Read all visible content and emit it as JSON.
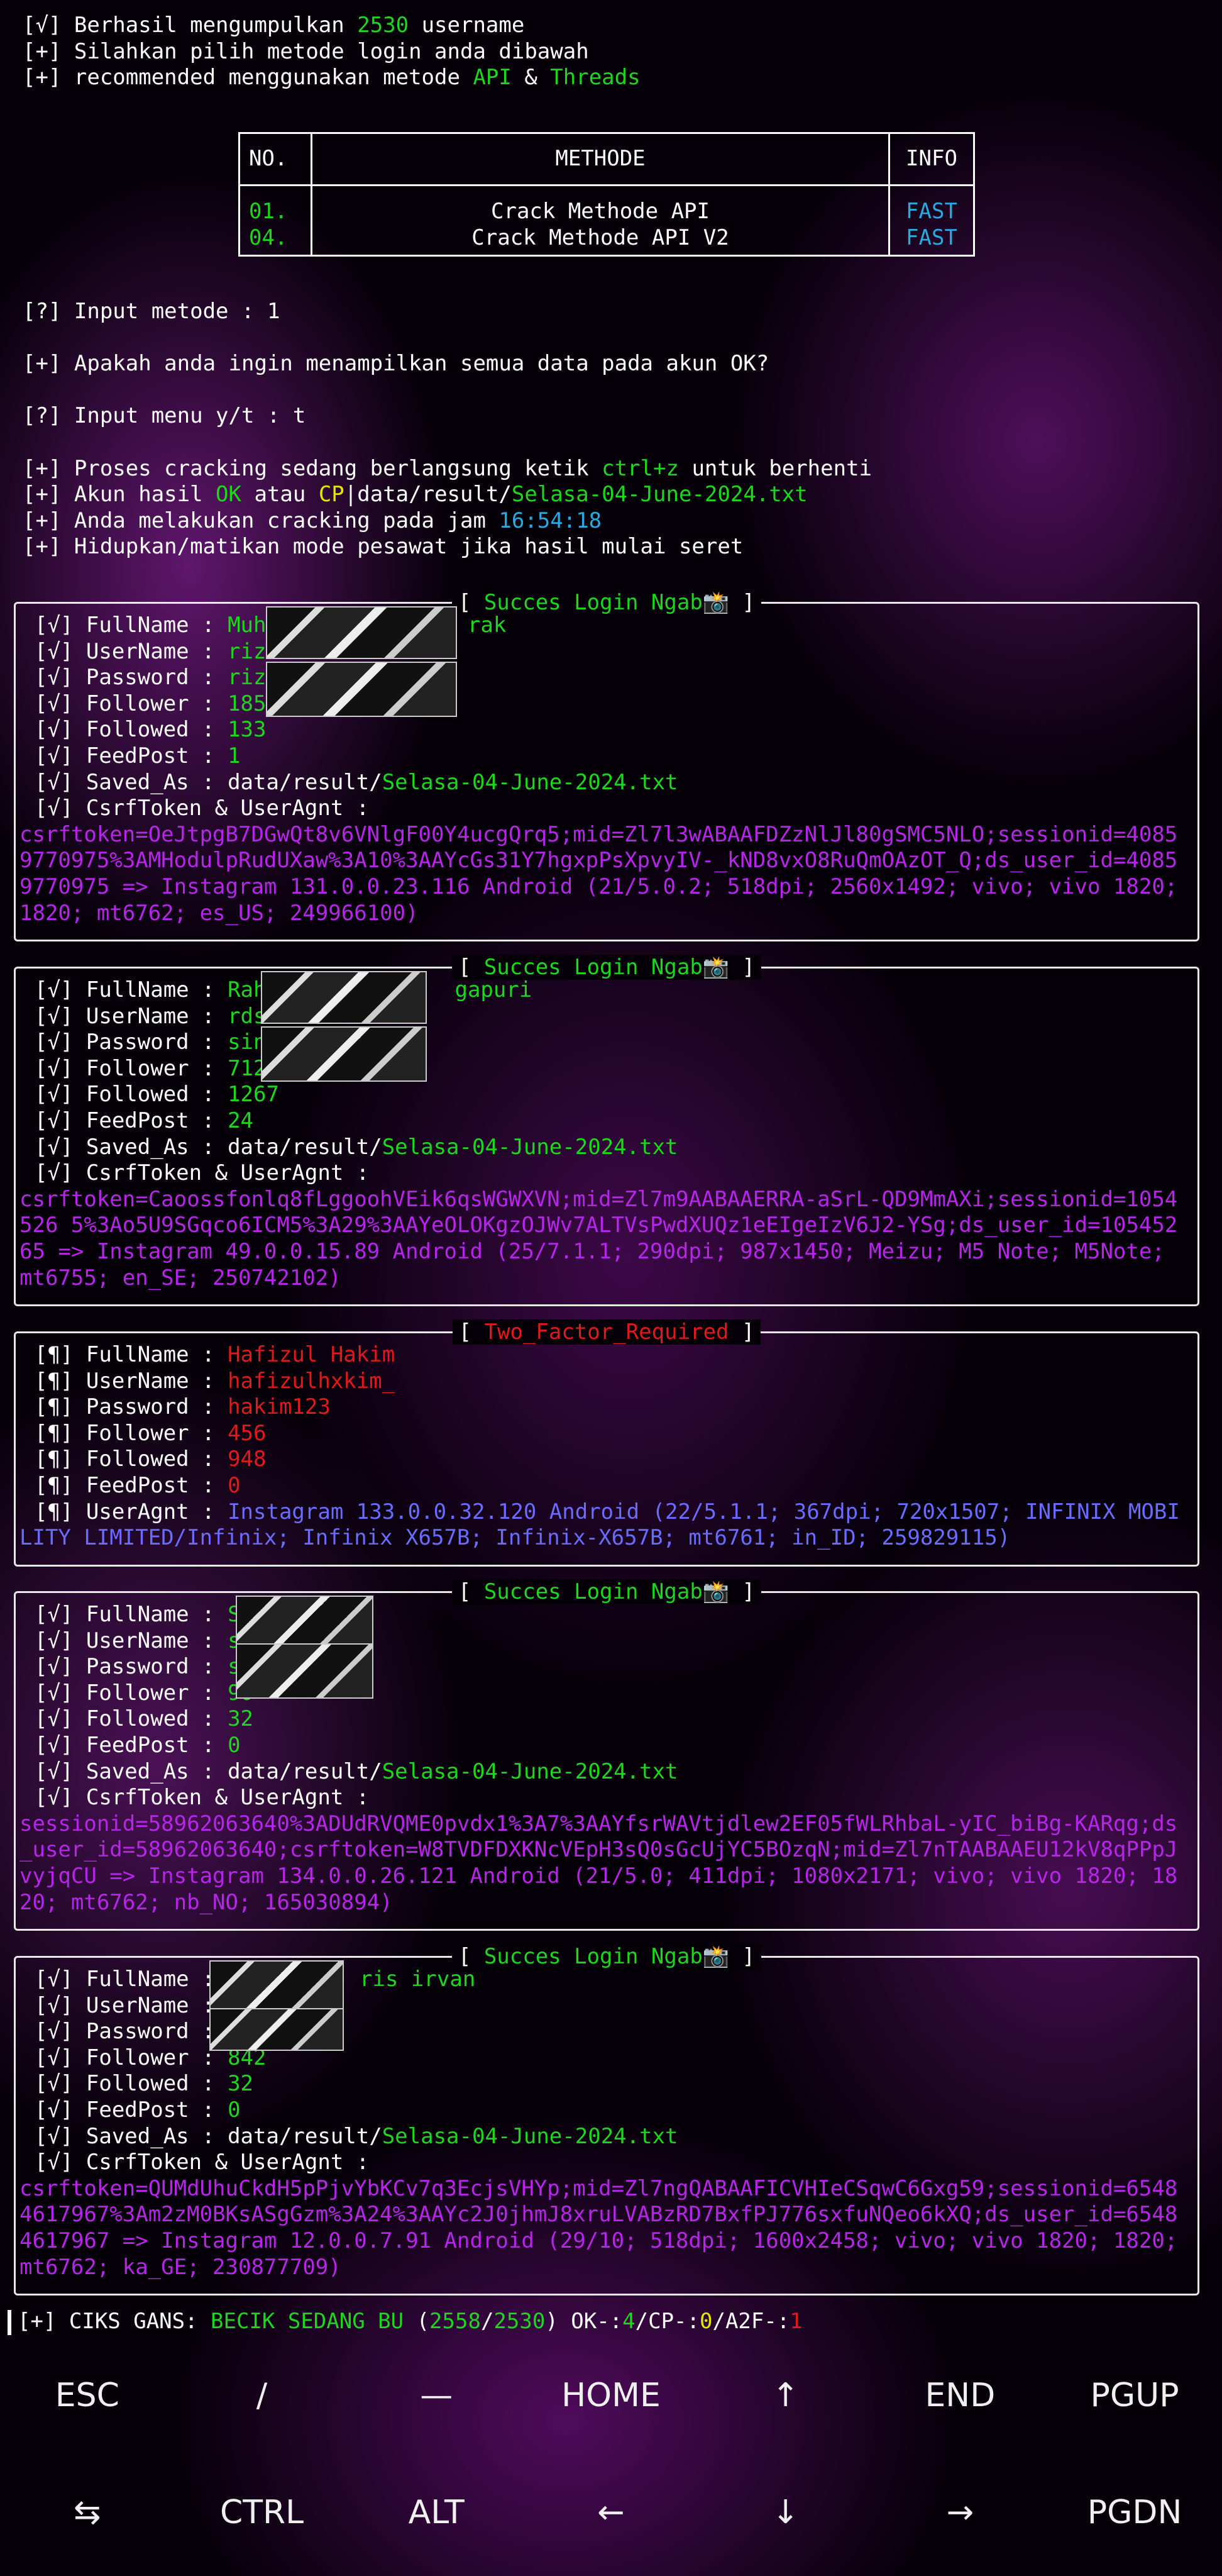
{
  "header": {
    "l1_prefix": "[√] Berhasil mengumpulkan ",
    "l1_count": "2530",
    "l1_suffix": " username",
    "l2": "[+] Silahkan pilih metode login anda dibawah",
    "l3_prefix": "[+] recommended menggunakan metode ",
    "l3_api": "API",
    "l3_and": " & ",
    "l3_threads": "Threads"
  },
  "menu": {
    "col_no": "NO.",
    "col_method": "METHODE",
    "col_info": "INFO",
    "rows": [
      {
        "no": "01.",
        "method": "Crack Methode API",
        "info": "FAST"
      },
      {
        "no": "04.",
        "method": "Crack Methode API V2",
        "info": "FAST"
      }
    ]
  },
  "prompts": {
    "input_metode": "[?] Input metode : 1",
    "show_all": "[+] Apakah anda ingin menampilkan semua data pada akun OK?",
    "input_menu": "[?] Input menu y/t : t",
    "p1_pre": "[+] Proses cracking sedang berlangsung ketik ",
    "p1_key": "ctrl+z",
    "p1_post": " untuk berhenti",
    "p2_pre": "[+] Akun hasil ",
    "p2_ok": "OK",
    "p2_mid": " atau ",
    "p2_cp": "CP",
    "p2_path": "|data/result/",
    "p2_file": "Selasa-04-June-2024.txt",
    "p3_pre": "[+] Anda melakukan cracking pada jam ",
    "p3_time": "16:54:18",
    "p4": "[+] Hidupkan/matikan mode pesawat jika hasil mulai seret"
  },
  "panels": [
    {
      "title": "Succes Login Ngab📸",
      "fullname": "Muha",
      "fullname_tail": "rak",
      "username": "rizk",
      "password": "rizk",
      "follower": "185",
      "followed": "133",
      "feedpost": "1",
      "saved_path": "data/result/",
      "saved_file": "Selasa-04-June-2024.txt",
      "token": "csrftoken=OeJtpgB7DGwQt8v6VNlgF00Y4ucgQrq5;mid=Zl7l3wABAAFDZzNlJl80gSMC5NLO;sessionid=40859770975%3AMHodulpRudUXaw%3A10%3AAYcGs31Y7hgxpPsXpvyIV-_kND8vxO8RuQmOAzOT_Q;ds_user_id=40859770975 => Instagram 131.0.0.23.116 Android (21/5.0.2; 518dpi; 2560x1492; vivo; vivo 1820; 1820; mt6762; es_US; 249966100)"
    },
    {
      "title": "Succes Login Ngab📸",
      "fullname": "Rah",
      "fullname_tail": "gapuri",
      "username": "rds",
      "password": "sin",
      "follower": "712",
      "followed": "1267",
      "feedpost": "24",
      "saved_path": "data/result/",
      "saved_file": "Selasa-04-June-2024.txt",
      "token": "csrftoken=Caoossfonlq8fLggoohVEik6qsWGWXVN;mid=Zl7m9AABAAERRA-aSrL-QD9MmAXi;sessionid=1054526 5%3Ao5U9SGqco6ICM5%3A29%3AAYeOLOKgzOJWv7ALTVsPwdXUQz1eEIgeIzV6J2-YSg;ds_user_id=10545265 => Instagram 49.0.0.15.89 Android (25/7.1.1; 290dpi; 987x1450; Meizu; M5 Note; M5Note; mt6755; en_SE; 250742102)"
    },
    {
      "title": "Two_Factor_Required",
      "fullname": "Hafizul Hakim",
      "username": "hafizulhxkim_",
      "password": "hakim123",
      "follower": "456",
      "followed": "948",
      "feedpost": "0",
      "useragent": "Instagram 133.0.0.32.120 Android (22/5.1.1; 367dpi; 720x1507; INFINIX MOBILITY LIMITED/Infinix; Infinix X657B; Infinix-X657B; mt6761; in_ID; 259829115)"
    },
    {
      "title": "Succes Login Ngab📸",
      "fullname": "S",
      "username": "s",
      "password": "s",
      "follower": "90",
      "followed": "32",
      "feedpost": "0",
      "saved_path": "data/result/",
      "saved_file": "Selasa-04-June-2024.txt",
      "token": "sessionid=58962063640%3ADUdRVQME0pvdx1%3A7%3AAYfsrWAVtjdlew2EF05fWLRhbaL-yIC_biBg-KARqg;ds_user_id=58962063640;csrftoken=W8TVDFDXKNcVEpH3sQ0sGcUjYC5BOzqN;mid=Zl7nTAABAAEU12kV8qPPpJvyjqCU => Instagram 134.0.0.26.121 Android (21/5.0; 411dpi; 1080x2171; vivo; vivo 1820; 1820; mt6762; nb_NO; 165030894)"
    },
    {
      "title": "Succes Login Ngab📸",
      "fullname": "",
      "fullname_tail": "ris irvan",
      "username": "",
      "password": "",
      "follower": "842",
      "followed": "32",
      "feedpost": "0",
      "saved_path": "data/result/",
      "saved_file": "Selasa-04-June-2024.txt",
      "token": "csrftoken=QUMdUhuCkdH5pPjvYbKCv7q3EcjsVHYp;mid=Zl7ngQABAAFICVHIeCSqwC6Gxg59;sessionid=65484617967%3Am2zM0BKsASgGzm%3A24%3AAYc2J0jhmJ8xruLVABzRD7BxfPJ776sxfuNQeo6kXQ;ds_user_id=65484617967 => Instagram 12.0.0.7.91 Android (29/10; 518dpi; 1600x2458; vivo; vivo 1820; 1820; mt6762; ka_GE; 230877709)"
    }
  ],
  "labels": {
    "fullname": "FullName : ",
    "username": "UserName : ",
    "password": "Password : ",
    "follower": "Follower : ",
    "followed": "Followed : ",
    "feedpost": "FeedPost : ",
    "saved": "Saved_As : ",
    "token": "CsrfToken & UserAgnt :",
    "useragent": "UserAgnt : ",
    "ok_mark": "[√] ",
    "tf_mark": "[¶] "
  },
  "status": {
    "pre": "[+] CIKS GANS: ",
    "state": "BECIK SEDANG BU",
    "open": " (",
    "progress": "2558",
    "slash": "/",
    "total": "2530",
    "close": ") OK-:",
    "ok": "4",
    "cp_label": "/CP-:",
    "cp": "0",
    "a2f_label": "/A2F-:",
    "a2f": "1"
  },
  "keyboard": {
    "row1": [
      "ESC",
      "/",
      "—",
      "HOME",
      "↑",
      "END",
      "PGUP"
    ],
    "row2": [
      "⇆",
      "CTRL",
      "ALT",
      "←",
      "↓",
      "→",
      "PGDN"
    ]
  }
}
